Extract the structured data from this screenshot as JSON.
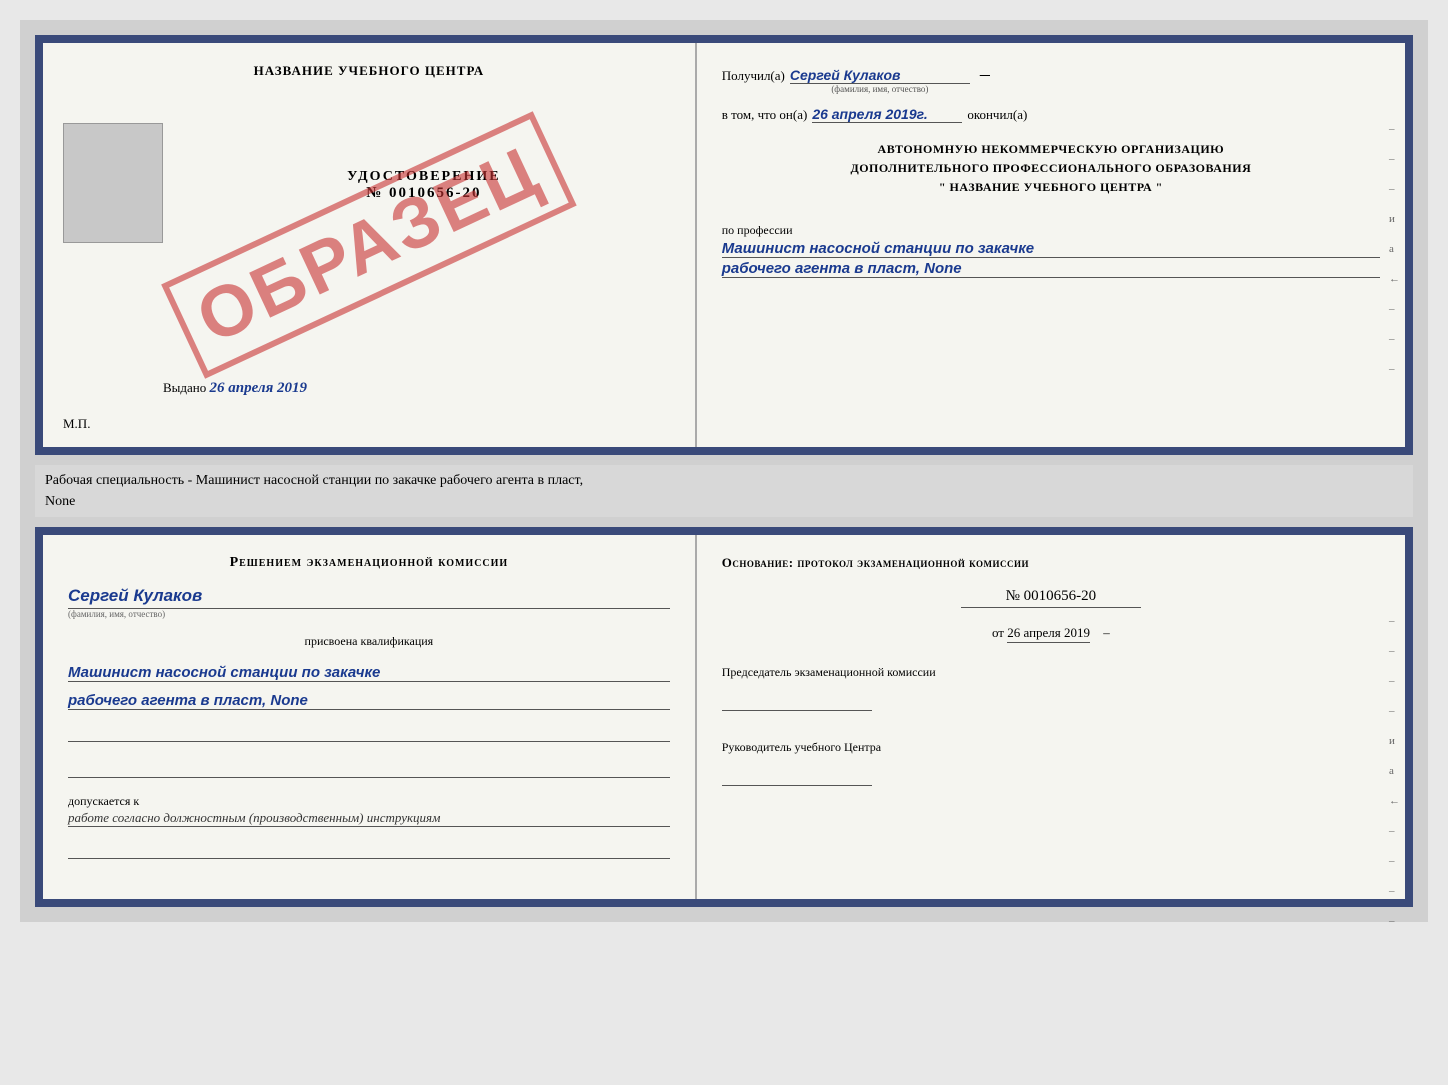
{
  "page": {
    "background": "#d0d0d0"
  },
  "top_cert": {
    "left": {
      "title": "НАЗВАНИЕ УЧЕБНОГО ЦЕНТРА",
      "doc_type": "УДОСТОВЕРЕНИЕ",
      "doc_number": "№ 0010656-20",
      "issued_label": "Выдано",
      "issued_date": "26 апреля 2019",
      "mp_label": "М.П.",
      "stamp_text": "ОБРАЗЕЦ"
    },
    "right": {
      "received_label": "Получил(а)",
      "person_name": "Сергей Кулаков",
      "name_hint": "(фамилия, имя, отчество)",
      "date_label": "в том, что он(а)",
      "date_value": "26 апреля 2019г.",
      "finished_label": "окончил(а)",
      "org_line1": "АВТОНОМНУЮ НЕКОММЕРЧЕСКУЮ ОРГАНИЗАЦИЮ",
      "org_line2": "ДОПОЛНИТЕЛЬНОГО ПРОФЕССИОНАЛЬНОГО ОБРАЗОВАНИЯ",
      "org_line3": "\" НАЗВАНИЕ УЧЕБНОГО ЦЕНТРА \"",
      "profession_label": "по профессии",
      "profession_line1": "Машинист насосной станции по закачке",
      "profession_line2": "рабочего агента в пласт, None",
      "side_marks": [
        "-",
        "-",
        "-",
        "и",
        "а",
        "←",
        "-",
        "-",
        "-"
      ]
    }
  },
  "middle": {
    "text": "Рабочая специальность - Машинист насосной станции по закачке рабочего агента в пласт,",
    "text2": "None"
  },
  "bottom_cert": {
    "left": {
      "commission_title": "Решением экзаменационной комиссии",
      "person_name": "Сергей Кулаков",
      "name_sublabel": "(фамилия, имя, отчество)",
      "assigned_label": "присвоена квалификация",
      "qualification_line1": "Машинист насосной станции по закачке",
      "qualification_line2": "рабочего агента в пласт, None",
      "admitted_label": "допускается к",
      "admitted_value": "работе согласно должностным (производственным) инструкциям"
    },
    "right": {
      "basis_title": "Основание: протокол экзаменационной комиссии",
      "protocol_number": "№ 0010656-20",
      "date_prefix": "от",
      "date_value": "26 апреля 2019",
      "chairman_title": "Председатель экзаменационной комиссии",
      "head_title": "Руководитель учебного Центра",
      "side_marks": [
        "-",
        "-",
        "-",
        "-",
        "и",
        "а",
        "←",
        "-",
        "-",
        "-",
        "-"
      ]
    }
  }
}
